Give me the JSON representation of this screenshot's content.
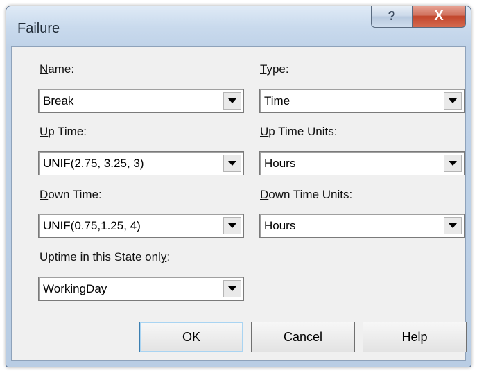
{
  "window": {
    "title": "Failure",
    "help_glyph": "?",
    "close_glyph": "X"
  },
  "fields": {
    "name": {
      "label_key": "N",
      "label_rest": "ame:",
      "value": "Break"
    },
    "type": {
      "label_key": "T",
      "label_rest": "ype:",
      "value": "Time"
    },
    "up_time": {
      "label_key": "U",
      "label_rest": "p Time:",
      "value": "UNIF(2.75, 3.25, 3)"
    },
    "up_time_units": {
      "label_key": "U",
      "label_rest": "p Time Units:",
      "value": "Hours"
    },
    "down_time": {
      "label_key": "D",
      "label_rest": "own Time:",
      "value": "UNIF(0.75,1.25, 4)"
    },
    "down_time_units": {
      "label_key": "D",
      "label_rest": "own Time Units:",
      "value": "Hours"
    },
    "uptime_state": {
      "label_pre": "Uptime in this State onl",
      "label_key": "y",
      "label_rest": ":",
      "value": "WorkingDay"
    }
  },
  "buttons": {
    "ok": "OK",
    "cancel": "Cancel",
    "help_key": "H",
    "help_rest": "elp"
  }
}
